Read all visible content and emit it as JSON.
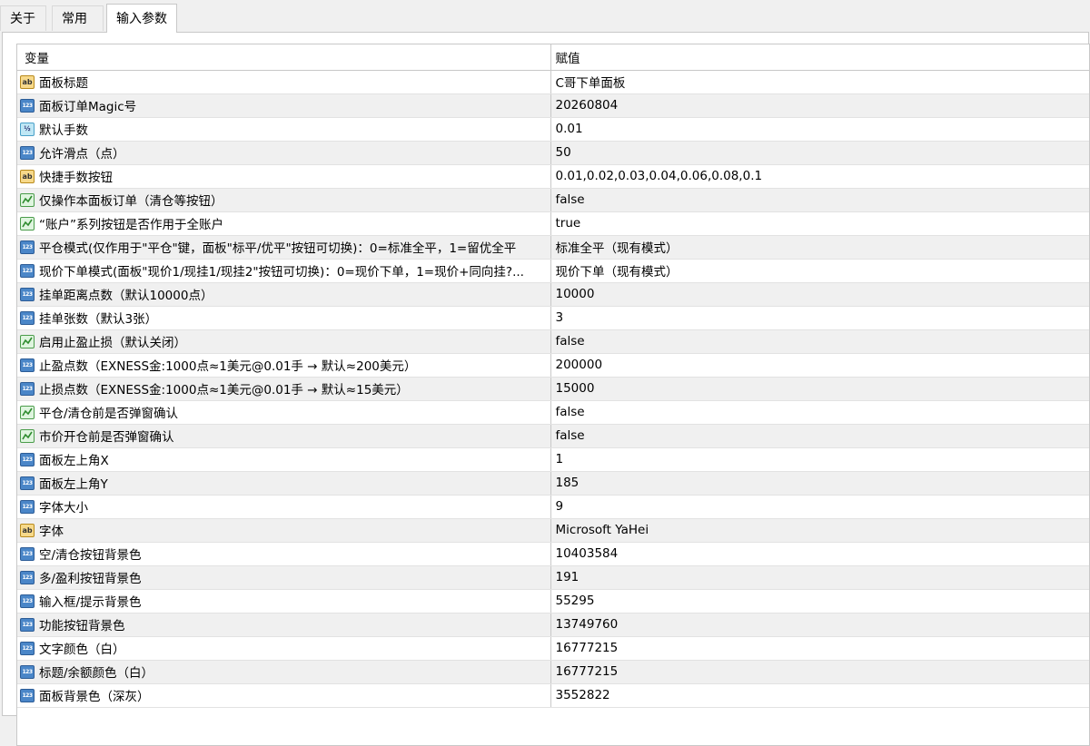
{
  "tabs": [
    {
      "label": "关于"
    },
    {
      "label": "常用"
    },
    {
      "label": "输入参数"
    }
  ],
  "active_tab": "输入参数",
  "table": {
    "col_variable": "变量",
    "col_value": "赋值",
    "rows": [
      {
        "type": "string",
        "name": "面板标题",
        "value": "C哥下单面板"
      },
      {
        "type": "int",
        "name": "面板订单Magic号",
        "value": "20260804"
      },
      {
        "type": "double",
        "name": "默认手数",
        "value": "0.01"
      },
      {
        "type": "int",
        "name": "允许滑点（点）",
        "value": "50"
      },
      {
        "type": "string",
        "name": "快捷手数按钮",
        "value": "0.01,0.02,0.03,0.04,0.06,0.08,0.1"
      },
      {
        "type": "bool",
        "name": "仅操作本面板订单（清仓等按钮）",
        "value": "false"
      },
      {
        "type": "bool",
        "name": "“账户”系列按钮是否作用于全账户",
        "value": "true"
      },
      {
        "type": "int",
        "name": "平仓模式(仅作用于\"平仓\"键，面板\"标平/优平\"按钮可切换)：0=标准全平，1=留优全平",
        "value": "标准全平（现有模式）"
      },
      {
        "type": "int",
        "name": "现价下单模式(面板\"现价1/现挂1/现挂2\"按钮可切换)：0=现价下单，1=现价+同向挂?...",
        "value": "现价下单（现有模式）"
      },
      {
        "type": "int",
        "name": "挂单距离点数（默认10000点）",
        "value": "10000"
      },
      {
        "type": "int",
        "name": "挂单张数（默认3张）",
        "value": "3"
      },
      {
        "type": "bool",
        "name": "启用止盈止损（默认关闭）",
        "value": "false"
      },
      {
        "type": "int",
        "name": "止盈点数（EXNESS金:1000点≈1美元@0.01手 → 默认≈200美元）",
        "value": "200000"
      },
      {
        "type": "int",
        "name": "止损点数（EXNESS金:1000点≈1美元@0.01手 → 默认≈15美元）",
        "value": "15000"
      },
      {
        "type": "bool",
        "name": "平仓/清仓前是否弹窗确认",
        "value": "false"
      },
      {
        "type": "bool",
        "name": "市价开仓前是否弹窗确认",
        "value": "false"
      },
      {
        "type": "int",
        "name": "面板左上角X",
        "value": "1"
      },
      {
        "type": "int",
        "name": "面板左上角Y",
        "value": "185"
      },
      {
        "type": "int",
        "name": "字体大小",
        "value": "9"
      },
      {
        "type": "string",
        "name": "字体",
        "value": "Microsoft YaHei"
      },
      {
        "type": "int",
        "name": "空/清仓按钮背景色",
        "value": "10403584"
      },
      {
        "type": "int",
        "name": "多/盈利按钮背景色",
        "value": "191"
      },
      {
        "type": "int",
        "name": "输入框/提示背景色",
        "value": "55295"
      },
      {
        "type": "int",
        "name": "功能按钮背景色",
        "value": "13749760"
      },
      {
        "type": "int",
        "name": "文字颜色（白）",
        "value": "16777215"
      },
      {
        "type": "int",
        "name": "标题/余额颜色（白）",
        "value": "16777215"
      },
      {
        "type": "int",
        "name": "面板背景色（深灰）",
        "value": "3552822"
      }
    ]
  },
  "icons": {
    "string": {
      "name": "string-type-icon",
      "glyph": "ab"
    },
    "int": {
      "name": "integer-type-icon",
      "glyph": "123"
    },
    "double": {
      "name": "double-type-icon",
      "glyph": "½"
    },
    "bool": {
      "name": "boolean-type-icon",
      "glyph": ""
    }
  },
  "colors": {
    "row_alt": "#f0f0f0",
    "border": "#c8c8c8"
  }
}
